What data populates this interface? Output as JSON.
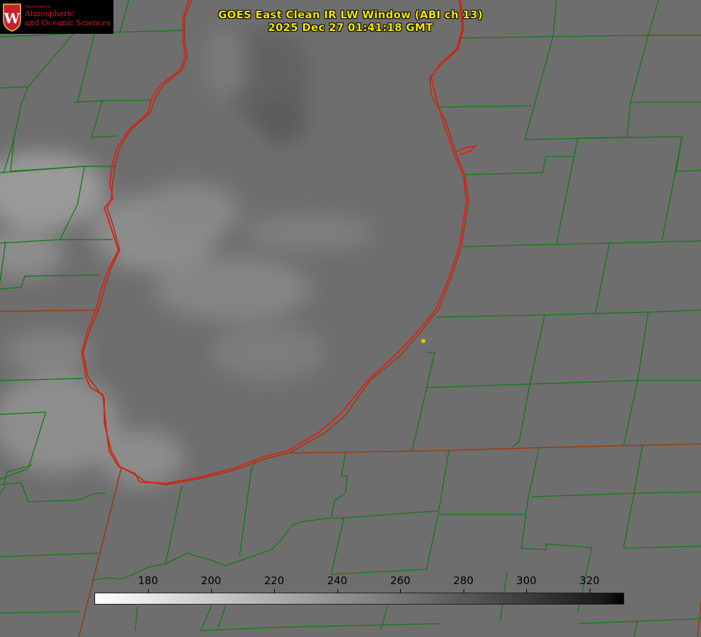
{
  "title": {
    "line1": "GOES East Clean IR LW Window (ABI ch 13)",
    "line2": "2025 Dec 27 01:41:18 GMT"
  },
  "logo": {
    "icon": "uw-crest-icon",
    "dept": "Department of",
    "line1": "Atmospheric",
    "line2": "and Oceanic Sciences",
    "brand_color": "#c7202f"
  },
  "colorbar": {
    "ticks": [
      "180",
      "200",
      "220",
      "240",
      "260",
      "280",
      "300",
      "320"
    ],
    "range": [
      163,
      331
    ],
    "colormap": "white-to-black"
  },
  "colors": {
    "county_lines": "#0f7a12",
    "lake_shoreline": "#e0201b",
    "state_lines": "#9a3b10",
    "marker": "#d9c600"
  }
}
